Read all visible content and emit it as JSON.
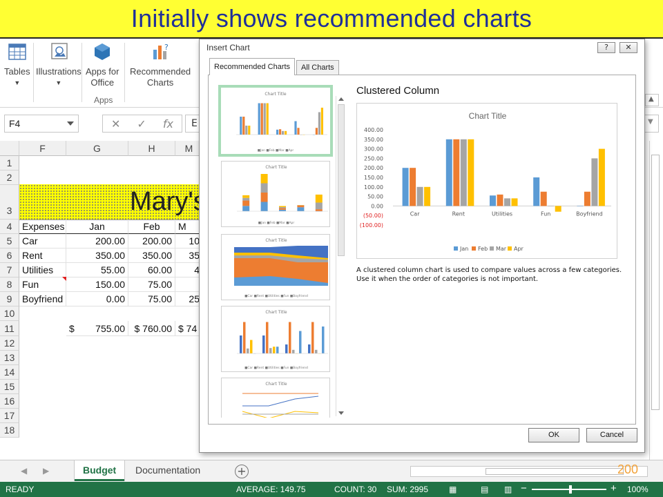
{
  "slide": {
    "banner": "Initially shows recommended charts",
    "page_number": "200"
  },
  "ribbon": {
    "tables": "Tables",
    "illustrations": "Illustrations",
    "apps_for_office_1": "Apps for",
    "apps_for_office_2": "Office",
    "recommended_1": "Recommended",
    "recommended_2": "Charts",
    "apps_group": "Apps"
  },
  "formula_bar": {
    "name_box": "F4",
    "fx": "fx",
    "content": "E"
  },
  "sheet": {
    "columns": [
      "F",
      "G",
      "H",
      "M"
    ],
    "rows": [
      "1",
      "2",
      "3",
      "4",
      "5",
      "6",
      "7",
      "8",
      "9",
      "10",
      "11",
      "12",
      "13",
      "14",
      "15",
      "16",
      "17",
      "18"
    ],
    "title_partial": "Mary's",
    "header": {
      "label": "Expenses",
      "jan": "Jan",
      "feb": "Feb",
      "mar": "M"
    },
    "data": [
      {
        "label": "Car",
        "jan": "200.00",
        "feb": "200.00",
        "mar": "10"
      },
      {
        "label": "Rent",
        "jan": "350.00",
        "feb": "350.00",
        "mar": "35"
      },
      {
        "label": "Utilities",
        "jan": "55.00",
        "feb": "60.00",
        "mar": "4"
      },
      {
        "label": "Fun",
        "jan": "150.00",
        "feb": "75.00",
        "mar": ""
      },
      {
        "label": "Boyfriend",
        "jan": "0.00",
        "feb": "75.00",
        "mar": "25"
      }
    ],
    "totals": {
      "jan_sym": "$",
      "jan": "755.00",
      "feb": "$ 760.00",
      "mar": "$ 74"
    }
  },
  "tabs": {
    "active": "Budget",
    "other": "Documentation",
    "add": "+"
  },
  "status": {
    "ready": "READY",
    "average": "AVERAGE: 149.75",
    "count": "COUNT: 30",
    "sum": "SUM: 2995",
    "zoom": "100%",
    "minus": "−",
    "plus": "+"
  },
  "dialog": {
    "title": "Insert Chart",
    "help": "?",
    "close": "✕",
    "tab_recommended": "Recommended Charts",
    "tab_all": "All Charts",
    "preview_heading": "Clustered Column",
    "description_1": "A clustered column chart is used to compare values across a few categories.",
    "description_2": "Use it when the order of categories is not important.",
    "ok": "OK",
    "cancel": "Cancel",
    "thumb_title": "Chart Title"
  },
  "chart_data": {
    "type": "bar",
    "title": "Chart Title",
    "categories": [
      "Car",
      "Rent",
      "Utilities",
      "Fun",
      "Boyfriend"
    ],
    "series": [
      {
        "name": "Jan",
        "color": "#5b9bd5",
        "values": [
          200,
          350,
          55,
          150,
          0
        ]
      },
      {
        "name": "Feb",
        "color": "#ed7d31",
        "values": [
          200,
          350,
          60,
          75,
          75
        ]
      },
      {
        "name": "Mar",
        "color": "#a5a5a5",
        "values": [
          100,
          350,
          40,
          0,
          250
        ]
      },
      {
        "name": "Apr",
        "color": "#ffc000",
        "values": [
          100,
          350,
          40,
          -30,
          300
        ]
      }
    ],
    "ylim": [
      -100,
      400
    ],
    "yticks": [
      "400.00",
      "350.00",
      "300.00",
      "250.00",
      "200.00",
      "150.00",
      "100.00",
      "50.00",
      "0.00",
      "(50.00)",
      "(100.00)"
    ],
    "legend": "bottom",
    "grid": false
  }
}
